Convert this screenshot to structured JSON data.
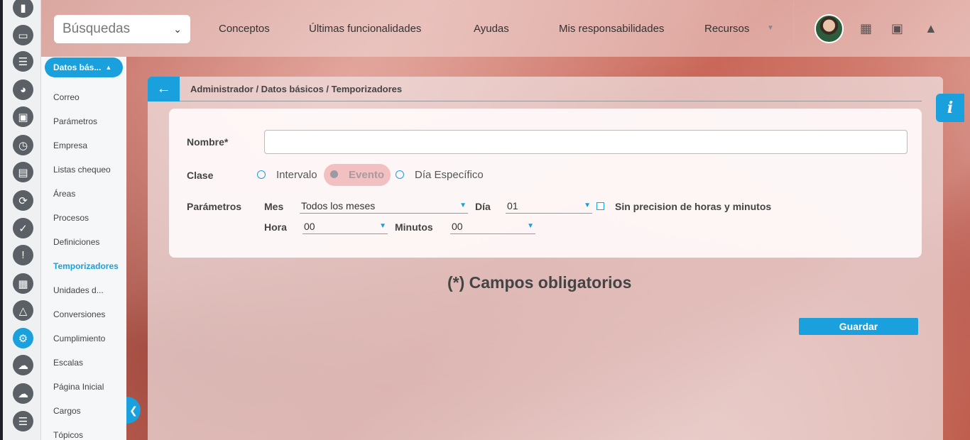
{
  "search": {
    "label": "Búsquedas"
  },
  "topmenu": [
    {
      "label": "Conceptos"
    },
    {
      "label": "Últimas funcionalidades"
    },
    {
      "label": "Ayudas"
    },
    {
      "label": "Mis responsabilidades"
    },
    {
      "label": "Recursos"
    }
  ],
  "sidebar": {
    "section": "Datos bás...",
    "items": [
      {
        "label": "Correo"
      },
      {
        "label": "Parámetros"
      },
      {
        "label": "Empresa"
      },
      {
        "label": "Listas chequeo"
      },
      {
        "label": "Áreas"
      },
      {
        "label": "Procesos"
      },
      {
        "label": "Definiciones"
      },
      {
        "label": "Temporizadores"
      },
      {
        "label": "Unidades d..."
      },
      {
        "label": "Conversiones"
      },
      {
        "label": "Cumplimiento"
      },
      {
        "label": "Escalas"
      },
      {
        "label": "Página Inicial"
      },
      {
        "label": "Cargos"
      },
      {
        "label": "Tópicos"
      }
    ],
    "active_item": "Temporizadores"
  },
  "breadcrumb": "Administrador / Datos básicos / Temporizadores",
  "form": {
    "name_label": "Nombre*",
    "name_value": "",
    "class_label": "Clase",
    "class_options": [
      "Intervalo",
      "Evento",
      "Día Específico"
    ],
    "class_selected": "Evento",
    "params_label": "Parámetros",
    "month_label": "Mes",
    "month_value": "Todos los meses",
    "day_label": "Día",
    "day_value": "01",
    "no_precision_label": "Sin precision de horas y minutos",
    "hour_label": "Hora",
    "hour_value": "00",
    "minutes_label": "Minutos",
    "minutes_value": "00"
  },
  "required_note": "(*) Campos obligatorios",
  "save_label": "Guardar",
  "colors": {
    "accent": "#1aa0dc",
    "rail": "#5b6066"
  }
}
